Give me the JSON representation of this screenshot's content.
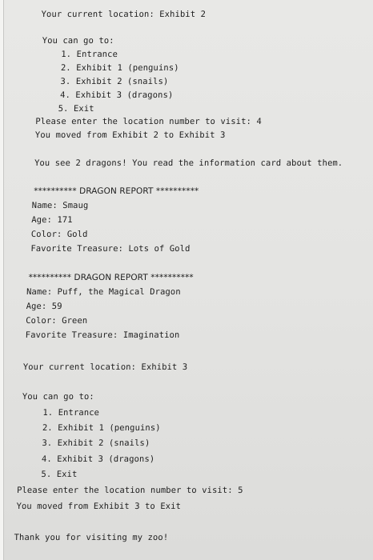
{
  "console": {
    "lines": {
      "l01": "Your current location: Exhibit 2",
      "l02": "You can go to:",
      "l03": "1. Entrance",
      "l04": "2. Exhibit 1 (penguins)",
      "l05": "3. Exhibit 2 (snails)",
      "l06": "4. Exhibit 3 (dragons)",
      "l07": "5. Exit",
      "l08": "Please enter the location number to visit: 4",
      "l09": "You moved from Exhibit 2 to Exhibit 3",
      "l10": "You see 2 dragons! You read the information card about them.",
      "l11": "********** DRAGON REPORT **********",
      "l12": "Name: Smaug",
      "l13": "Age: 171",
      "l14": "Color: Gold",
      "l15": "Favorite Treasure: Lots of Gold",
      "l16": "********** DRAGON REPORT **********",
      "l17": "Name: Puff, the Magical Dragon",
      "l18": "Age: 59",
      "l19": "Color: Green",
      "l20": "Favorite Treasure: Imagination",
      "l21": "Your current location: Exhibit 3",
      "l22": "You can go to:",
      "l23": "1. Entrance",
      "l24": "2. Exhibit 1 (penguins)",
      "l25": "3. Exhibit 2 (snails)",
      "l26": "4. Exhibit 3 (dragons)",
      "l27": "5. Exit",
      "l28": "Please enter the location number to visit: 5",
      "l29": "You moved from Exhibit 3 to Exit",
      "l30": "Thank you for visiting my zoo!"
    }
  }
}
